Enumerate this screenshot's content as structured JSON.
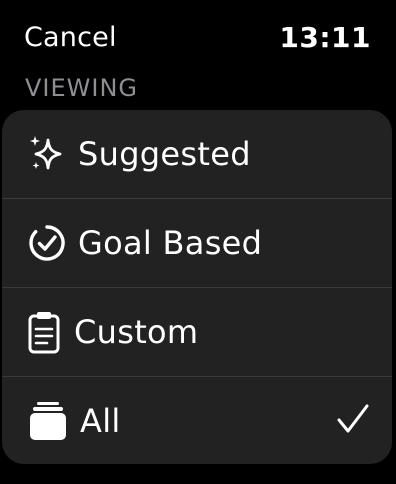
{
  "header": {
    "cancel_label": "Cancel",
    "time": "13:11"
  },
  "section": {
    "title": "VIEWING"
  },
  "items": [
    {
      "label": "Suggested",
      "icon": "sparkles-icon",
      "selected": false
    },
    {
      "label": "Goal Based",
      "icon": "goal-circle-check-icon",
      "selected": false
    },
    {
      "label": "Custom",
      "icon": "clipboard-icon",
      "selected": false
    },
    {
      "label": "All",
      "icon": "stack-icon",
      "selected": true
    }
  ],
  "colors": {
    "background": "#000000",
    "list_background": "#222222",
    "divider": "#3a3a3c",
    "header_text": "#8e8e93",
    "text": "#ffffff"
  }
}
